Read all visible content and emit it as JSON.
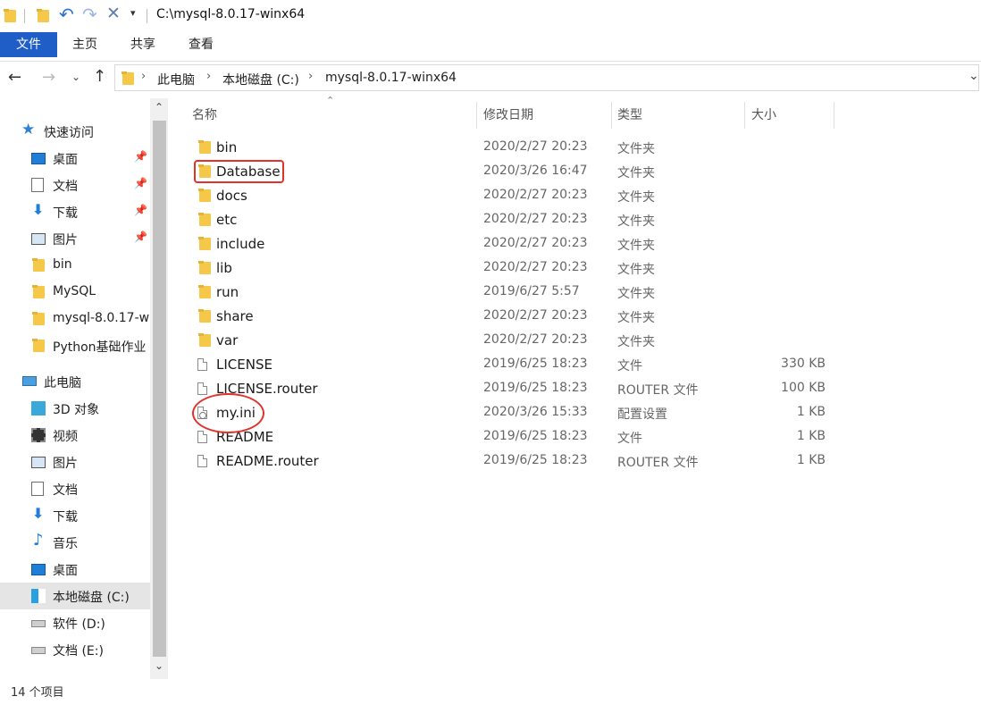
{
  "window": {
    "title": "C:\\mysql-8.0.17-winx64"
  },
  "ribbon": {
    "file_tab": "文件",
    "tabs": [
      "主页",
      "共享",
      "查看"
    ]
  },
  "address": {
    "crumbs": [
      "此电脑",
      "本地磁盘 (C:)",
      "mysql-8.0.17-winx64"
    ]
  },
  "nav": {
    "quick_access": "快速访问",
    "quick_items": [
      {
        "label": "桌面",
        "icon": "desktop-icon",
        "pinned": true
      },
      {
        "label": "文档",
        "icon": "document-icon",
        "pinned": true
      },
      {
        "label": "下载",
        "icon": "download-icon",
        "pinned": true
      },
      {
        "label": "图片",
        "icon": "picture-icon",
        "pinned": true
      },
      {
        "label": "bin",
        "icon": "folder-icon",
        "pinned": false
      },
      {
        "label": "MySQL",
        "icon": "folder-icon",
        "pinned": false
      },
      {
        "label": "mysql-8.0.17-w",
        "icon": "folder-icon",
        "pinned": false
      },
      {
        "label": "Python基础作业",
        "icon": "folder-icon",
        "pinned": false
      }
    ],
    "this_pc": "此电脑",
    "pc_items": [
      {
        "label": "3D 对象",
        "icon": "3d-objects-icon"
      },
      {
        "label": "视频",
        "icon": "video-icon"
      },
      {
        "label": "图片",
        "icon": "picture-icon"
      },
      {
        "label": "文档",
        "icon": "document-icon"
      },
      {
        "label": "下载",
        "icon": "download-icon"
      },
      {
        "label": "音乐",
        "icon": "music-icon"
      },
      {
        "label": "桌面",
        "icon": "desktop-icon"
      },
      {
        "label": "本地磁盘 (C:)",
        "icon": "windows-drive-icon",
        "selected": true
      },
      {
        "label": "软件 (D:)",
        "icon": "drive-icon"
      },
      {
        "label": "文档 (E:)",
        "icon": "drive-icon"
      }
    ]
  },
  "list": {
    "columns": [
      "名称",
      "修改日期",
      "类型",
      "大小"
    ],
    "rows": [
      {
        "name": "bin",
        "date": "2020/2/27 20:23",
        "type": "文件夹",
        "size": "",
        "kind": "folder"
      },
      {
        "name": "Database",
        "date": "2020/3/26 16:47",
        "type": "文件夹",
        "size": "",
        "kind": "folder"
      },
      {
        "name": "docs",
        "date": "2020/2/27 20:23",
        "type": "文件夹",
        "size": "",
        "kind": "folder"
      },
      {
        "name": "etc",
        "date": "2020/2/27 20:23",
        "type": "文件夹",
        "size": "",
        "kind": "folder"
      },
      {
        "name": "include",
        "date": "2020/2/27 20:23",
        "type": "文件夹",
        "size": "",
        "kind": "folder"
      },
      {
        "name": "lib",
        "date": "2020/2/27 20:23",
        "type": "文件夹",
        "size": "",
        "kind": "folder"
      },
      {
        "name": "run",
        "date": "2019/6/27 5:57",
        "type": "文件夹",
        "size": "",
        "kind": "folder"
      },
      {
        "name": "share",
        "date": "2020/2/27 20:23",
        "type": "文件夹",
        "size": "",
        "kind": "folder"
      },
      {
        "name": "var",
        "date": "2020/2/27 20:23",
        "type": "文件夹",
        "size": "",
        "kind": "folder"
      },
      {
        "name": "LICENSE",
        "date": "2019/6/25 18:23",
        "type": "文件",
        "size": "330 KB",
        "kind": "file"
      },
      {
        "name": "LICENSE.router",
        "date": "2019/6/25 18:23",
        "type": "ROUTER 文件",
        "size": "100 KB",
        "kind": "file"
      },
      {
        "name": "my.ini",
        "date": "2020/3/26 15:33",
        "type": "配置设置",
        "size": "1 KB",
        "kind": "ini"
      },
      {
        "name": "README",
        "date": "2019/6/25 18:23",
        "type": "文件",
        "size": "1 KB",
        "kind": "file"
      },
      {
        "name": "README.router",
        "date": "2019/6/25 18:23",
        "type": "ROUTER 文件",
        "size": "1 KB",
        "kind": "file"
      }
    ]
  },
  "status": {
    "count": "14 个项目"
  },
  "colors": {
    "accent": "#1e5ec6",
    "folder": "#f6c84a",
    "highlight": "#e0322b"
  }
}
